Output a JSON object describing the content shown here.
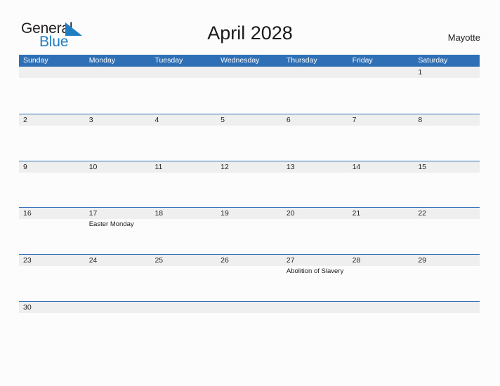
{
  "brand": {
    "name_part1": "General",
    "name_part2": "Blue",
    "accent_color": "#1f7dc4"
  },
  "header": {
    "title": "April 2028",
    "region": "Mayotte"
  },
  "theme": {
    "header_blue": "#2f6fb5",
    "day_band_gray": "#efefef",
    "page_background": "#fcfcfc"
  },
  "calendar": {
    "weekdays": [
      "Sunday",
      "Monday",
      "Tuesday",
      "Wednesday",
      "Thursday",
      "Friday",
      "Saturday"
    ],
    "weeks": [
      [
        {
          "day": "",
          "events": []
        },
        {
          "day": "",
          "events": []
        },
        {
          "day": "",
          "events": []
        },
        {
          "day": "",
          "events": []
        },
        {
          "day": "",
          "events": []
        },
        {
          "day": "",
          "events": []
        },
        {
          "day": "1",
          "events": []
        }
      ],
      [
        {
          "day": "2",
          "events": []
        },
        {
          "day": "3",
          "events": []
        },
        {
          "day": "4",
          "events": []
        },
        {
          "day": "5",
          "events": []
        },
        {
          "day": "6",
          "events": []
        },
        {
          "day": "7",
          "events": []
        },
        {
          "day": "8",
          "events": []
        }
      ],
      [
        {
          "day": "9",
          "events": []
        },
        {
          "day": "10",
          "events": []
        },
        {
          "day": "11",
          "events": []
        },
        {
          "day": "12",
          "events": []
        },
        {
          "day": "13",
          "events": []
        },
        {
          "day": "14",
          "events": []
        },
        {
          "day": "15",
          "events": []
        }
      ],
      [
        {
          "day": "16",
          "events": []
        },
        {
          "day": "17",
          "events": [
            "Easter Monday"
          ]
        },
        {
          "day": "18",
          "events": []
        },
        {
          "day": "19",
          "events": []
        },
        {
          "day": "20",
          "events": []
        },
        {
          "day": "21",
          "events": []
        },
        {
          "day": "22",
          "events": []
        }
      ],
      [
        {
          "day": "23",
          "events": []
        },
        {
          "day": "24",
          "events": []
        },
        {
          "day": "25",
          "events": []
        },
        {
          "day": "26",
          "events": []
        },
        {
          "day": "27",
          "events": [
            "Abolition of Slavery"
          ]
        },
        {
          "day": "28",
          "events": []
        },
        {
          "day": "29",
          "events": []
        }
      ],
      [
        {
          "day": "30",
          "events": []
        },
        {
          "day": "",
          "events": []
        },
        {
          "day": "",
          "events": []
        },
        {
          "day": "",
          "events": []
        },
        {
          "day": "",
          "events": []
        },
        {
          "day": "",
          "events": []
        },
        {
          "day": "",
          "events": []
        }
      ]
    ]
  }
}
